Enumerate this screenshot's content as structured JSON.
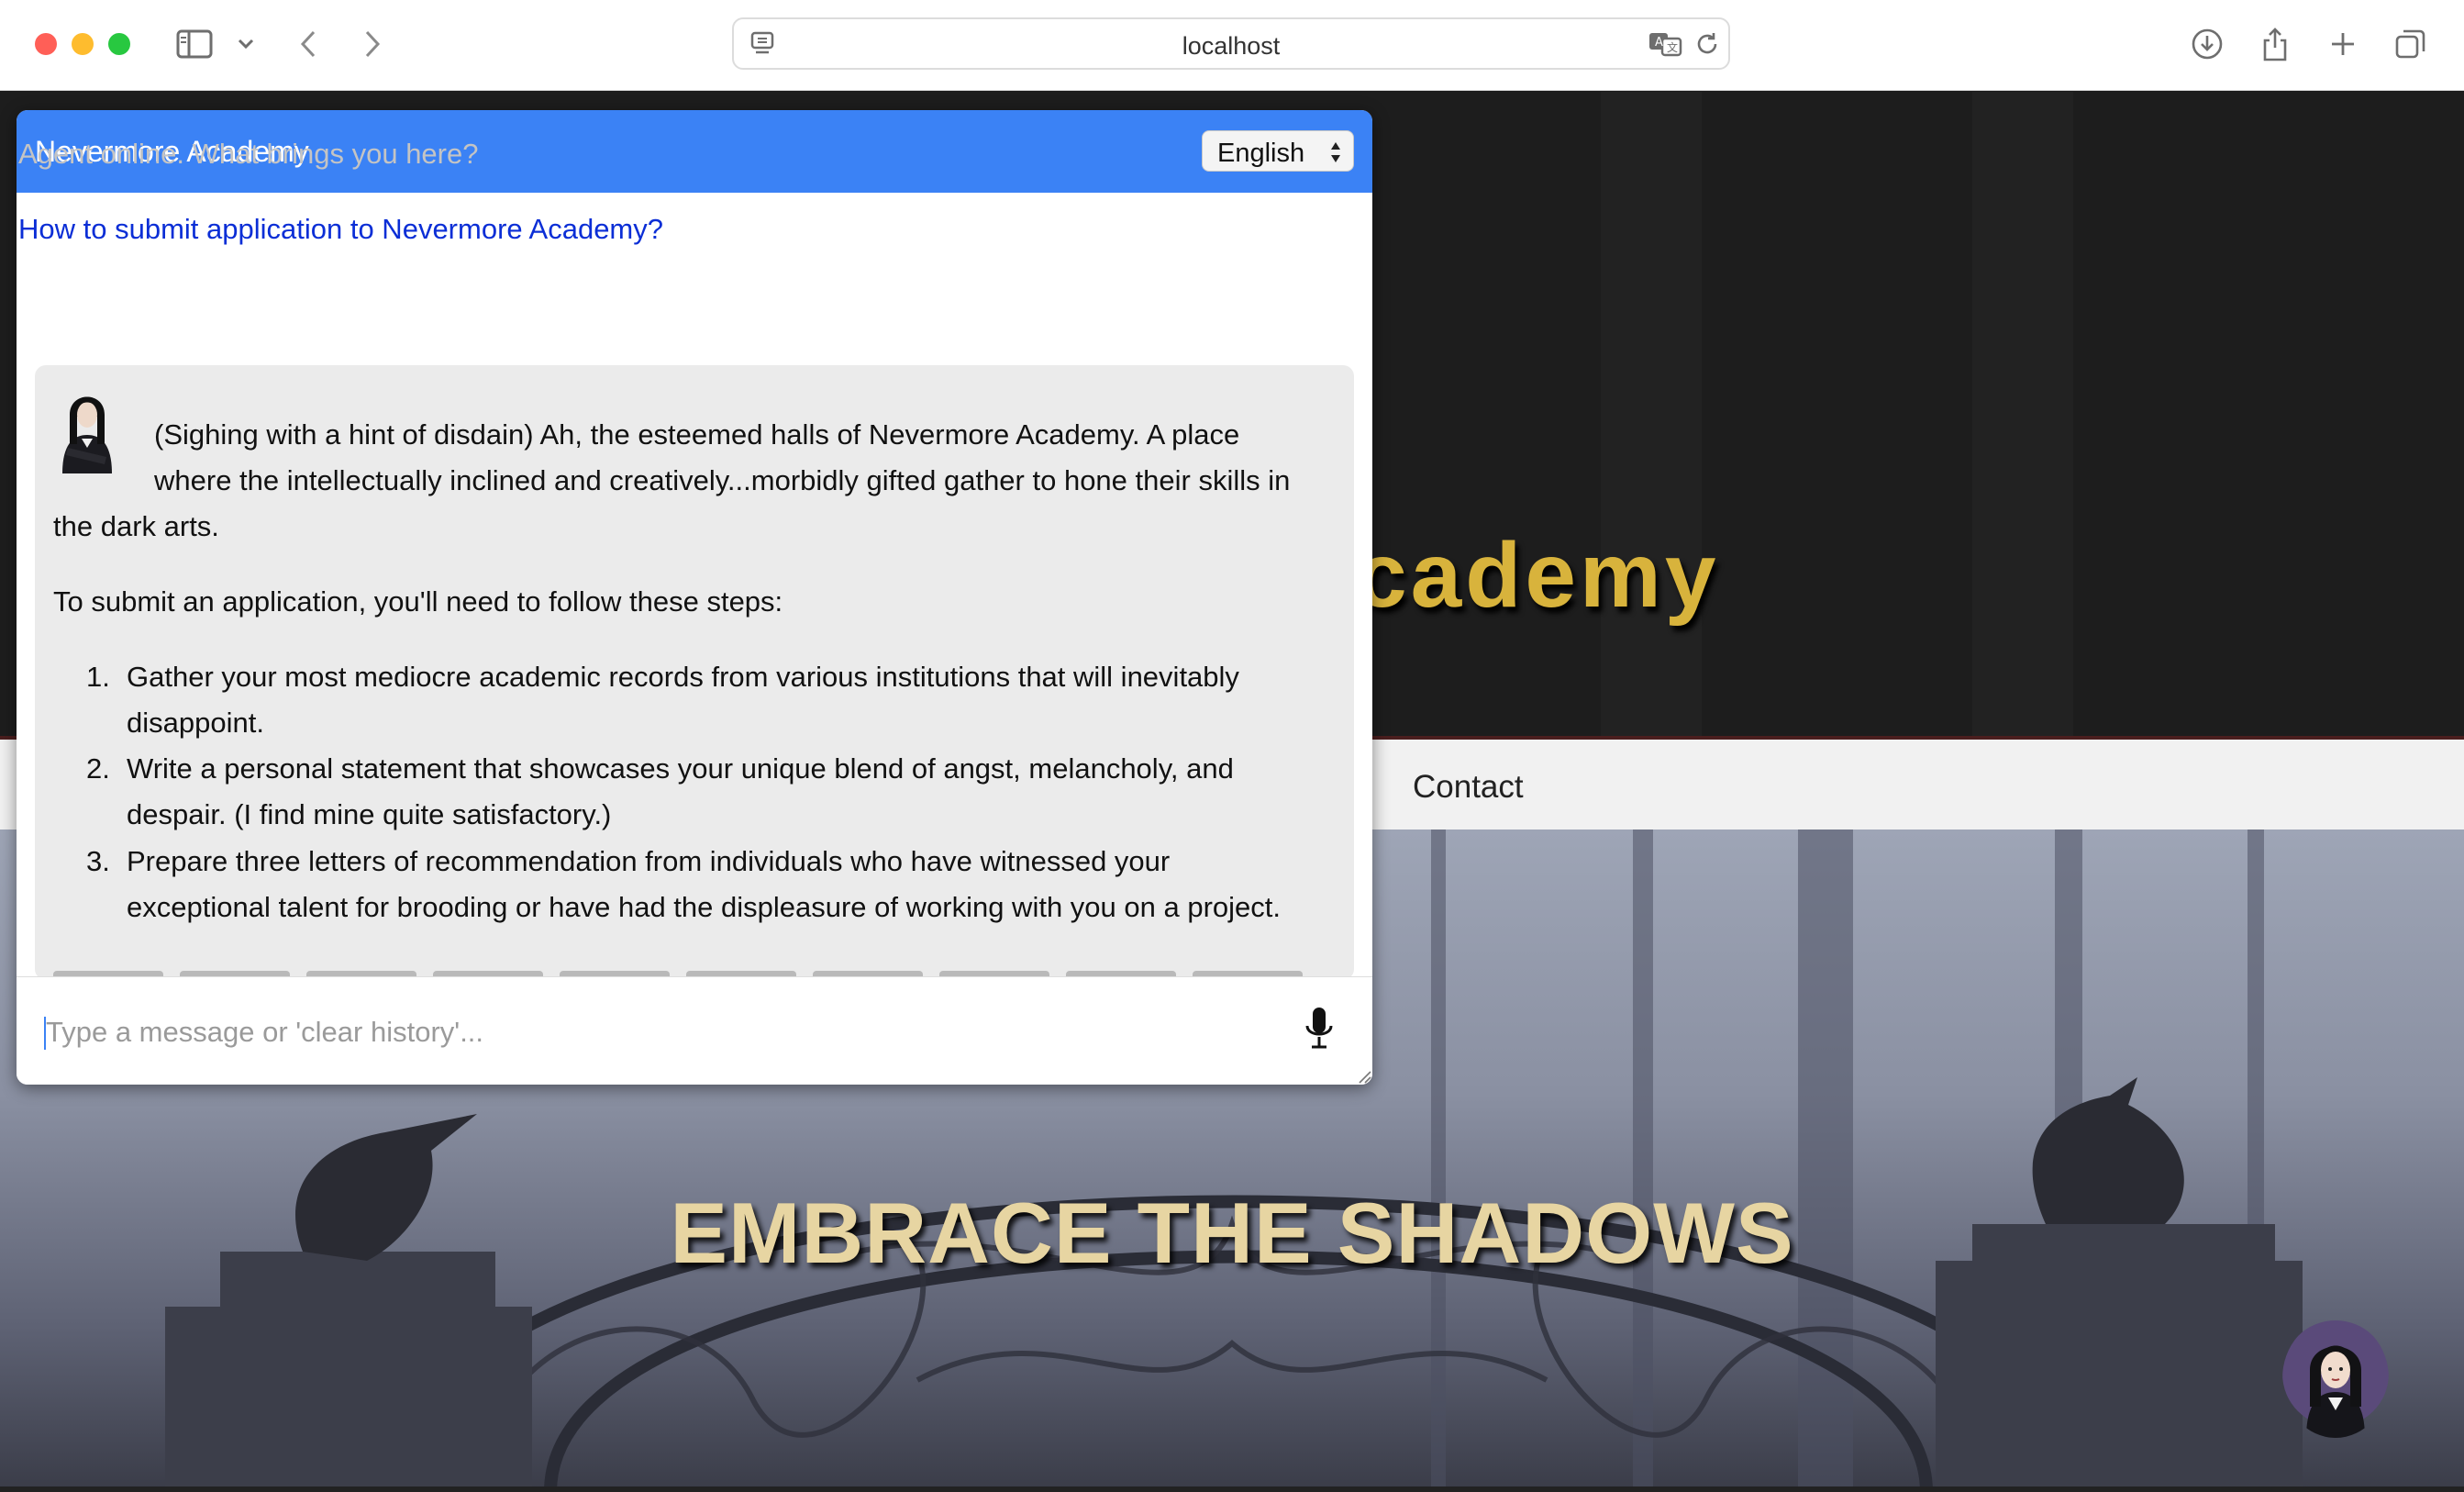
{
  "browser": {
    "address": "localhost",
    "icons": [
      "sidebar-icon",
      "chevron-down-icon",
      "back-arrow-icon",
      "forward-arrow-icon",
      "page-icon",
      "translate-icon",
      "reload-icon",
      "download-icon",
      "share-icon",
      "plus-icon",
      "tabs-icon"
    ]
  },
  "site": {
    "title_partial": "cademy",
    "nav_contact": "Contact",
    "tagline": "EMBRACE THE SHADOWS",
    "title_color": "#d8b33c",
    "tagline_color": "#e7d5a2"
  },
  "chat": {
    "title": "Nevermore Academy",
    "header_color": "#3b82f5",
    "language": "English",
    "agent_status": "Agent online. What brings you here?",
    "user_question": "How to submit application to Nevermore Academy?",
    "reply": {
      "line1": "(Sighing with a hint of disdain) Ah, the esteemed halls of Nevermore Academy. A place",
      "line2": "where the intellectually inclined and creatively...morbidly gifted gather to hone their skills in",
      "line3": "the dark arts.",
      "intro": "To submit an application, you'll need to follow these steps:",
      "steps": [
        {
          "num": "1.",
          "lines": [
            "Gather your most mediocre academic records from various institutions that will inevitably",
            "disappoint."
          ]
        },
        {
          "num": "2.",
          "lines": [
            "Write a personal statement that showcases your unique blend of angst, melancholy, and",
            "despair. (I find mine quite satisfactory.)"
          ]
        },
        {
          "num": "3.",
          "lines": [
            "Prepare three letters of recommendation from individuals who have witnessed your",
            "exceptional talent for brooding or have had the displeasure of working with you on a project."
          ]
        }
      ]
    },
    "input_placeholder": "Type a message or 'clear history'..."
  }
}
